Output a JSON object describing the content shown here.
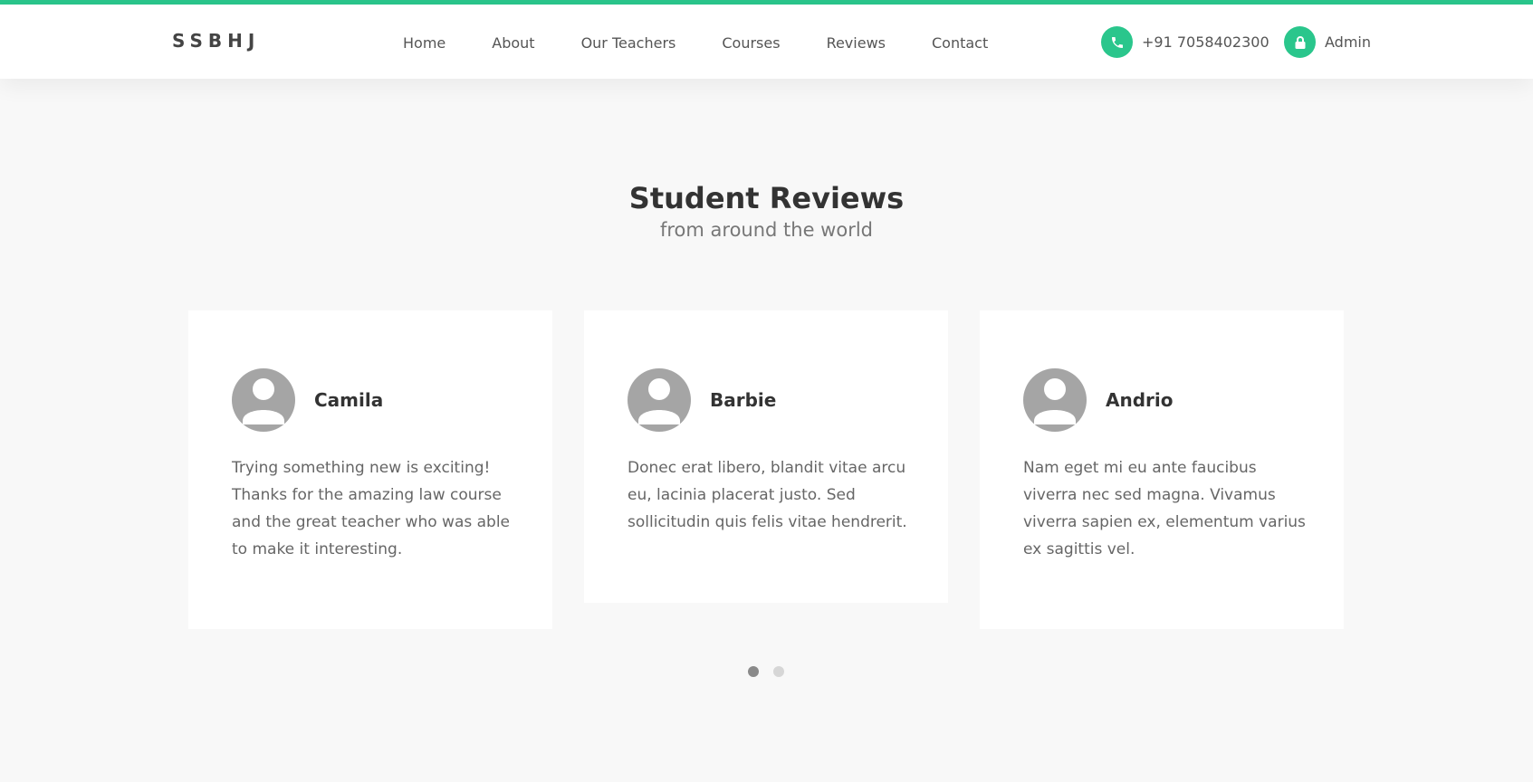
{
  "header": {
    "brand": "SSBHJ",
    "nav": [
      "Home",
      "About",
      "Our Teachers",
      "Courses",
      "Reviews",
      "Contact"
    ],
    "phone": "+91 7058402300",
    "admin_label": "Admin",
    "phone_icon": "phone-icon",
    "admin_icon": "lock-icon"
  },
  "section": {
    "title": "Student Reviews",
    "subtitle": "from around the world"
  },
  "reviews": [
    {
      "name": "Camila",
      "text": "Trying something new is exciting! Thanks for the amazing law course and the great teacher who was able to make it interesting."
    },
    {
      "name": "Barbie",
      "text": "Donec erat libero, blandit vitae arcu eu, lacinia placerat justo. Sed sollicitudin quis felis vitae hendrerit."
    },
    {
      "name": "Andrio",
      "text": "Nam eget mi eu ante faucibus viverra nec sed magna. Vivamus viverra sapien ex, elementum varius ex sagittis vel."
    }
  ],
  "carousel": {
    "pages": 2,
    "active_page": 1
  },
  "colors": {
    "accent": "#2ac68c",
    "background": "#f8f8f8",
    "avatar": "#a5a5a5",
    "dot_active": "#8a8a8a",
    "dot_inactive": "#d6d6d6"
  }
}
